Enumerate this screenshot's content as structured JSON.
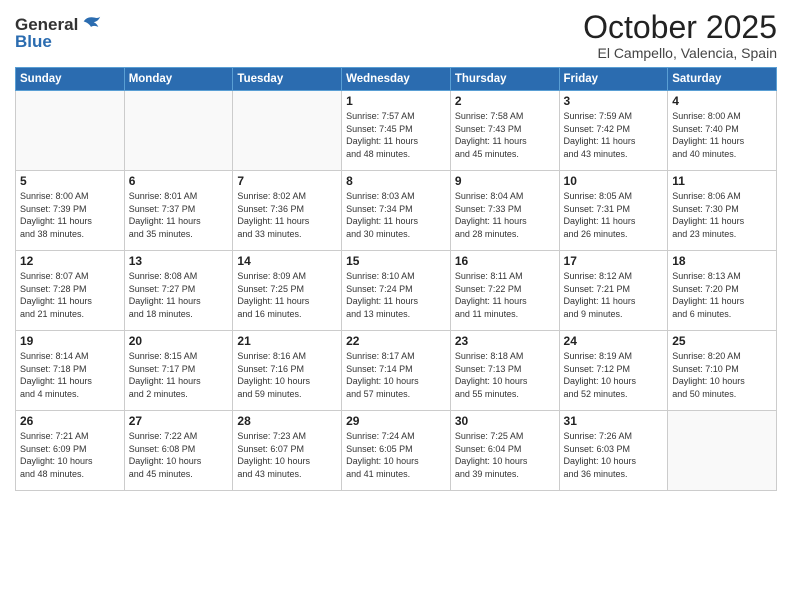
{
  "header": {
    "logo_line1": "General",
    "logo_line2": "Blue",
    "month": "October 2025",
    "location": "El Campello, Valencia, Spain"
  },
  "weekdays": [
    "Sunday",
    "Monday",
    "Tuesday",
    "Wednesday",
    "Thursday",
    "Friday",
    "Saturday"
  ],
  "weeks": [
    [
      {
        "day": "",
        "info": ""
      },
      {
        "day": "",
        "info": ""
      },
      {
        "day": "",
        "info": ""
      },
      {
        "day": "1",
        "info": "Sunrise: 7:57 AM\nSunset: 7:45 PM\nDaylight: 11 hours\nand 48 minutes."
      },
      {
        "day": "2",
        "info": "Sunrise: 7:58 AM\nSunset: 7:43 PM\nDaylight: 11 hours\nand 45 minutes."
      },
      {
        "day": "3",
        "info": "Sunrise: 7:59 AM\nSunset: 7:42 PM\nDaylight: 11 hours\nand 43 minutes."
      },
      {
        "day": "4",
        "info": "Sunrise: 8:00 AM\nSunset: 7:40 PM\nDaylight: 11 hours\nand 40 minutes."
      }
    ],
    [
      {
        "day": "5",
        "info": "Sunrise: 8:00 AM\nSunset: 7:39 PM\nDaylight: 11 hours\nand 38 minutes."
      },
      {
        "day": "6",
        "info": "Sunrise: 8:01 AM\nSunset: 7:37 PM\nDaylight: 11 hours\nand 35 minutes."
      },
      {
        "day": "7",
        "info": "Sunrise: 8:02 AM\nSunset: 7:36 PM\nDaylight: 11 hours\nand 33 minutes."
      },
      {
        "day": "8",
        "info": "Sunrise: 8:03 AM\nSunset: 7:34 PM\nDaylight: 11 hours\nand 30 minutes."
      },
      {
        "day": "9",
        "info": "Sunrise: 8:04 AM\nSunset: 7:33 PM\nDaylight: 11 hours\nand 28 minutes."
      },
      {
        "day": "10",
        "info": "Sunrise: 8:05 AM\nSunset: 7:31 PM\nDaylight: 11 hours\nand 26 minutes."
      },
      {
        "day": "11",
        "info": "Sunrise: 8:06 AM\nSunset: 7:30 PM\nDaylight: 11 hours\nand 23 minutes."
      }
    ],
    [
      {
        "day": "12",
        "info": "Sunrise: 8:07 AM\nSunset: 7:28 PM\nDaylight: 11 hours\nand 21 minutes."
      },
      {
        "day": "13",
        "info": "Sunrise: 8:08 AM\nSunset: 7:27 PM\nDaylight: 11 hours\nand 18 minutes."
      },
      {
        "day": "14",
        "info": "Sunrise: 8:09 AM\nSunset: 7:25 PM\nDaylight: 11 hours\nand 16 minutes."
      },
      {
        "day": "15",
        "info": "Sunrise: 8:10 AM\nSunset: 7:24 PM\nDaylight: 11 hours\nand 13 minutes."
      },
      {
        "day": "16",
        "info": "Sunrise: 8:11 AM\nSunset: 7:22 PM\nDaylight: 11 hours\nand 11 minutes."
      },
      {
        "day": "17",
        "info": "Sunrise: 8:12 AM\nSunset: 7:21 PM\nDaylight: 11 hours\nand 9 minutes."
      },
      {
        "day": "18",
        "info": "Sunrise: 8:13 AM\nSunset: 7:20 PM\nDaylight: 11 hours\nand 6 minutes."
      }
    ],
    [
      {
        "day": "19",
        "info": "Sunrise: 8:14 AM\nSunset: 7:18 PM\nDaylight: 11 hours\nand 4 minutes."
      },
      {
        "day": "20",
        "info": "Sunrise: 8:15 AM\nSunset: 7:17 PM\nDaylight: 11 hours\nand 2 minutes."
      },
      {
        "day": "21",
        "info": "Sunrise: 8:16 AM\nSunset: 7:16 PM\nDaylight: 10 hours\nand 59 minutes."
      },
      {
        "day": "22",
        "info": "Sunrise: 8:17 AM\nSunset: 7:14 PM\nDaylight: 10 hours\nand 57 minutes."
      },
      {
        "day": "23",
        "info": "Sunrise: 8:18 AM\nSunset: 7:13 PM\nDaylight: 10 hours\nand 55 minutes."
      },
      {
        "day": "24",
        "info": "Sunrise: 8:19 AM\nSunset: 7:12 PM\nDaylight: 10 hours\nand 52 minutes."
      },
      {
        "day": "25",
        "info": "Sunrise: 8:20 AM\nSunset: 7:10 PM\nDaylight: 10 hours\nand 50 minutes."
      }
    ],
    [
      {
        "day": "26",
        "info": "Sunrise: 7:21 AM\nSunset: 6:09 PM\nDaylight: 10 hours\nand 48 minutes."
      },
      {
        "day": "27",
        "info": "Sunrise: 7:22 AM\nSunset: 6:08 PM\nDaylight: 10 hours\nand 45 minutes."
      },
      {
        "day": "28",
        "info": "Sunrise: 7:23 AM\nSunset: 6:07 PM\nDaylight: 10 hours\nand 43 minutes."
      },
      {
        "day": "29",
        "info": "Sunrise: 7:24 AM\nSunset: 6:05 PM\nDaylight: 10 hours\nand 41 minutes."
      },
      {
        "day": "30",
        "info": "Sunrise: 7:25 AM\nSunset: 6:04 PM\nDaylight: 10 hours\nand 39 minutes."
      },
      {
        "day": "31",
        "info": "Sunrise: 7:26 AM\nSunset: 6:03 PM\nDaylight: 10 hours\nand 36 minutes."
      },
      {
        "day": "",
        "info": ""
      }
    ]
  ]
}
